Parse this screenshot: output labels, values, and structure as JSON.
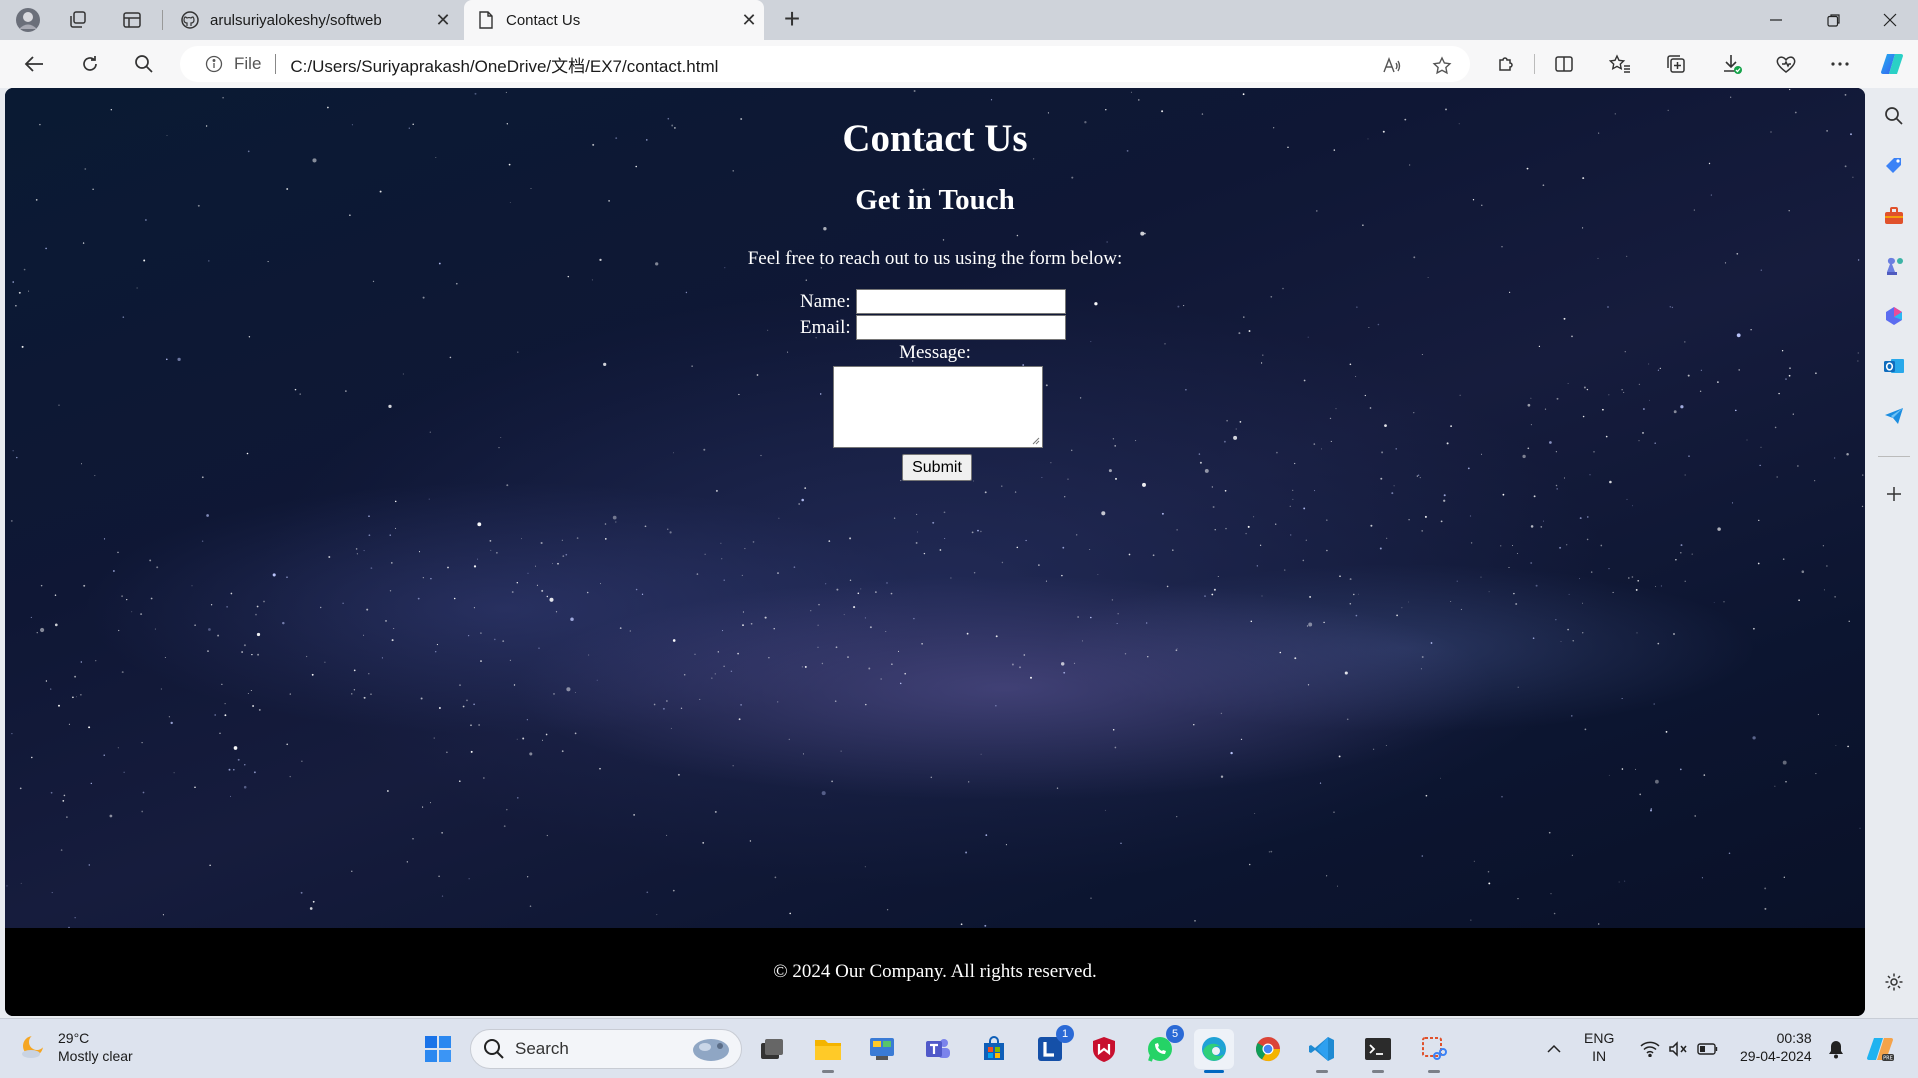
{
  "browser": {
    "tabs": [
      {
        "title": "arulsuriyalokeshy/softweb",
        "active": false
      },
      {
        "title": "Contact Us",
        "active": true
      }
    ],
    "address": {
      "scheme": "File",
      "url": "C:/Users/Suriyaprakash/OneDrive/文档/EX7/contact.html"
    }
  },
  "page": {
    "title": "Contact Us",
    "subtitle": "Get in Touch",
    "intro": "Feel free to reach out to us using the form below:",
    "form": {
      "name_label": "Name:",
      "email_label": "Email:",
      "message_label": "Message:",
      "name_value": "",
      "email_value": "",
      "message_value": "",
      "submit_label": "Submit"
    },
    "footer": "© 2024 Our Company. All rights reserved."
  },
  "taskbar": {
    "weather": {
      "temp": "29°C",
      "condition": "Mostly clear"
    },
    "search_placeholder": "Search",
    "badges": {
      "linkedin": "1",
      "whatsapp": "5"
    },
    "language": {
      "lang": "ENG",
      "region": "IN"
    },
    "clock": {
      "time": "00:38",
      "date": "29-04-2024"
    }
  },
  "colors": {
    "accent": "#0067c0",
    "page_text": "#ffffff",
    "footer_bg": "#000000"
  }
}
